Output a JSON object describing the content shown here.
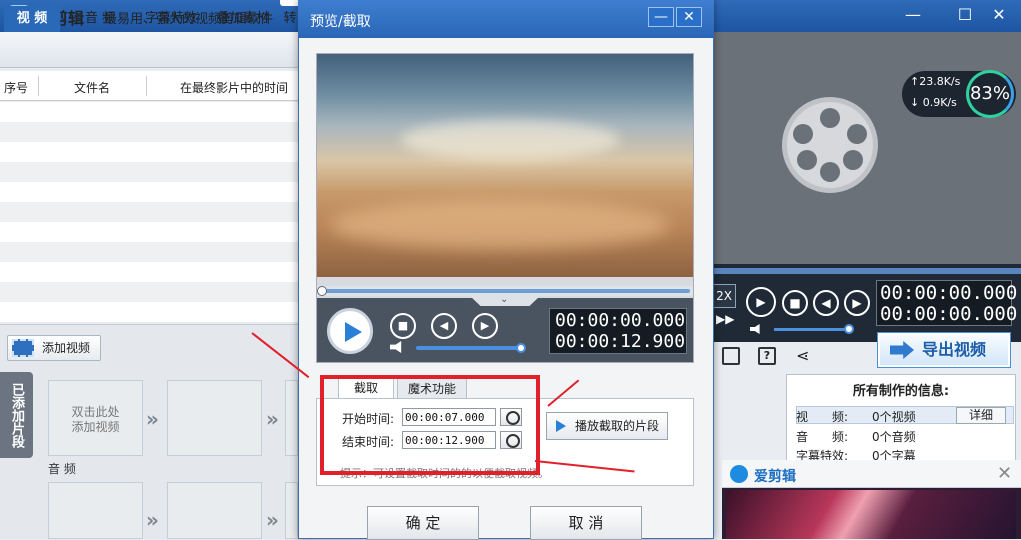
{
  "app": {
    "name": "爱剪辑",
    "slogan": "最易用、强大的视频剪辑软件",
    "win_min": "—",
    "win_max": "☐",
    "win_close": "✕"
  },
  "main_tabs": [
    "视 频",
    "音 频",
    "字幕特效",
    "叠加素材",
    "转"
  ],
  "file_table": {
    "headers": [
      "序号",
      "文件名",
      "在最终影片中的时间"
    ]
  },
  "left_lower": {
    "add_video": "添加视频",
    "added_label": "已添加片段",
    "slot_hint": "双击此处\n添加视频",
    "audio_label": "音 频",
    "arrow": "»"
  },
  "right_panel": {
    "upload_speed": "↑23.8K/s",
    "download_speed": "↓ 0.9K/s",
    "cpu_percent": "83%",
    "time_current": "00:00:00.000",
    "time_total": "00:00:00.000",
    "speed_label": "2X",
    "export_label": "导出视频",
    "info_title": "所有制作的信息:",
    "info_rows": [
      {
        "label": "视　　频:",
        "value": "0个视频"
      },
      {
        "label": "音　　频:",
        "value": "0个音频"
      },
      {
        "label": "字幕特效:",
        "value": "0个字幕"
      }
    ],
    "detail_label": "详细"
  },
  "popup": {
    "title": "爱剪辑",
    "close": "✕"
  },
  "dialog": {
    "title": "预览/截取",
    "minimize": "—",
    "close": "✕",
    "time_current": "00:00:00.000",
    "time_total": "00:00:12.900",
    "tab_cut": "截取",
    "tab_magic": "魔术功能",
    "start_label": "开始时间:",
    "start_value": "00:00:07.000",
    "end_label": "结束时间:",
    "end_value": "00:00:12.900",
    "play_segment": "播放截取的片段",
    "tip": "提示：可设置截取时间的的以便截取视频。",
    "ok": "确 定",
    "cancel": "取 消"
  },
  "colors": {
    "title_bar": "#2a66b6",
    "highlight": "#e0202a",
    "accent": "#2a7fd8"
  },
  "icons": [
    "app-logo-icon",
    "film-icon",
    "play-icon",
    "stop-icon",
    "prev-icon",
    "next-icon",
    "volume-icon",
    "clock-icon",
    "export-icon",
    "save-icon",
    "help-icon",
    "share-icon",
    "reel-icon"
  ]
}
